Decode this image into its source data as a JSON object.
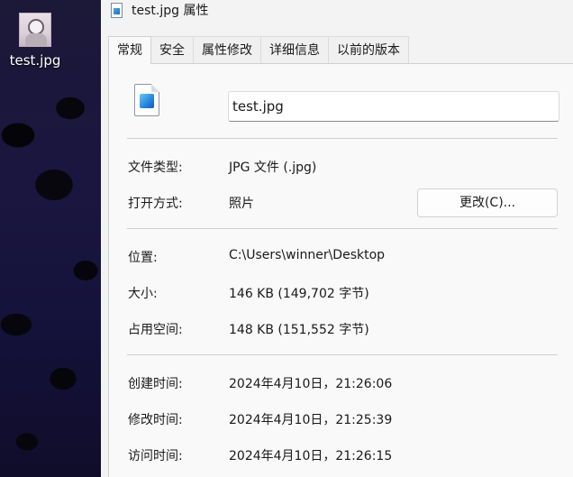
{
  "desktop": {
    "icon_label": "test.jpg"
  },
  "window": {
    "title": "test.jpg 属性",
    "tabs": [
      "常规",
      "安全",
      "属性修改",
      "详细信息",
      "以前的版本"
    ]
  },
  "general": {
    "file_name": "test.jpg",
    "type_label": "文件类型:",
    "type_value": "JPG 文件 (.jpg)",
    "opens_with_label": "打开方式:",
    "opens_with_value": "照片",
    "change_button": "更改(C)...",
    "location_label": "位置:",
    "location_value": "C:\\Users\\winner\\Desktop",
    "size_label": "大小:",
    "size_value": "146 KB (149,702 字节)",
    "size_on_disk_label": "占用空间:",
    "size_on_disk_value": "148 KB (151,552 字节)",
    "created_label": "创建时间:",
    "created_value": "2024年4月10日，21:26:06",
    "modified_label": "修改时间:",
    "modified_value": "2024年4月10日，21:25:39",
    "accessed_label": "访问时间:",
    "accessed_value": "2024年4月10日，21:26:15"
  }
}
